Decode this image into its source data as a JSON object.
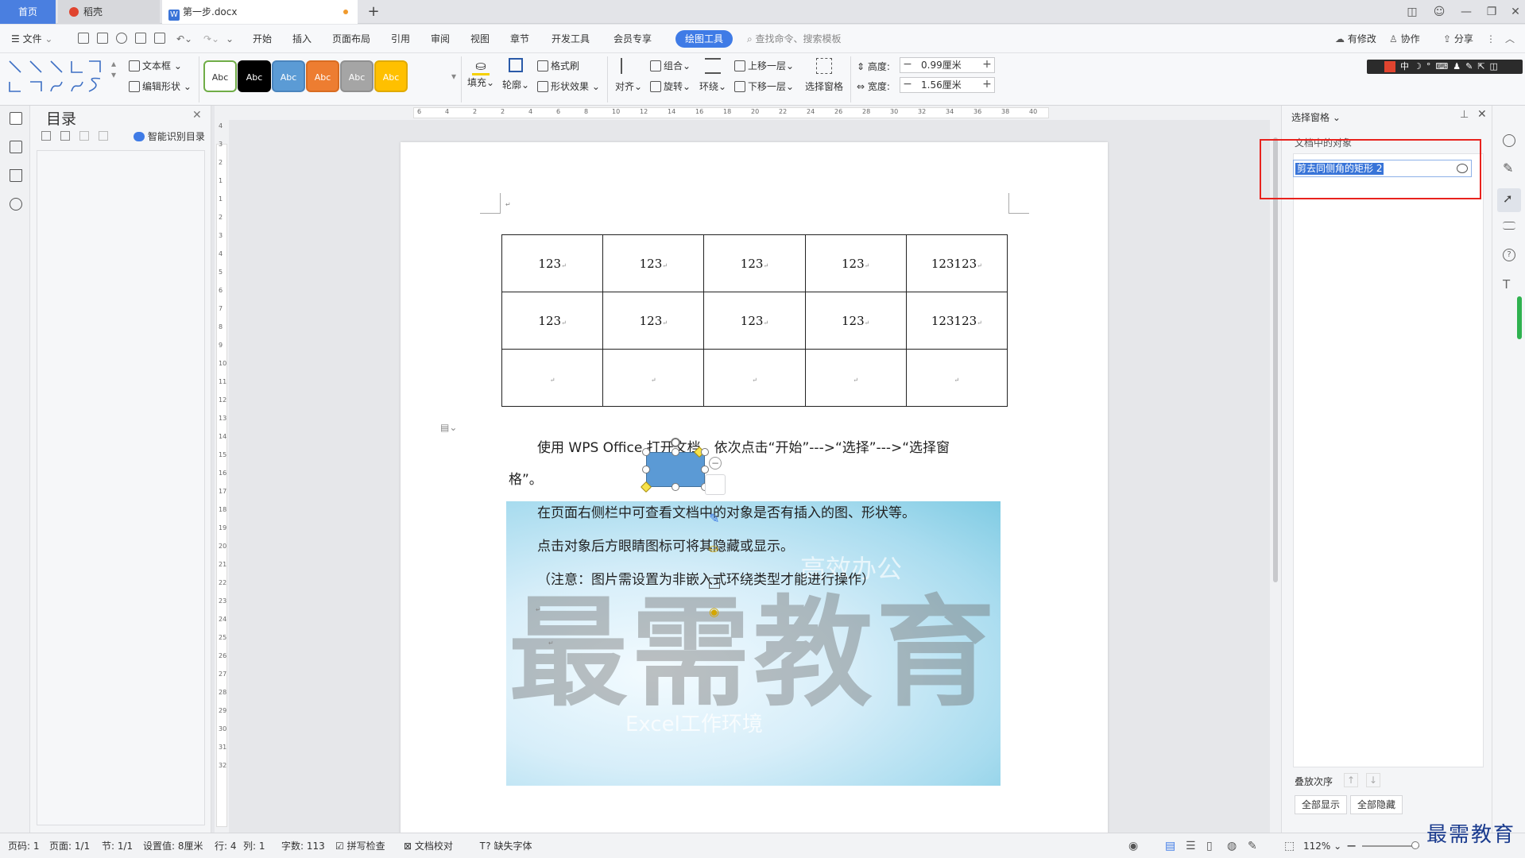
{
  "tabs": {
    "home": "首页",
    "daoke": "稻壳",
    "doc": "第一步.docx",
    "add": "+"
  },
  "menu": {
    "file": "文件",
    "items": [
      "开始",
      "插入",
      "页面布局",
      "引用",
      "审阅",
      "视图",
      "章节",
      "开发工具",
      "会员专享"
    ],
    "active": "绘图工具",
    "search": "查找命令、搜索模板",
    "right": [
      "有修改",
      "协作",
      "分享"
    ]
  },
  "ribbon": {
    "textbox": "文本框",
    "edit_shape": "编辑形状",
    "styles": [
      {
        "label": "Abc",
        "bg": "#ffffff",
        "fg": "#333333",
        "border": "#70ad47"
      },
      {
        "label": "Abc",
        "bg": "#000000",
        "fg": "#ffffff",
        "border": "#000000"
      },
      {
        "label": "Abc",
        "bg": "#5b9bd5",
        "fg": "#ffffff",
        "border": "#4a84bd"
      },
      {
        "label": "Abc",
        "bg": "#ed7d31",
        "fg": "#ffffff",
        "border": "#d86c22"
      },
      {
        "label": "Abc",
        "bg": "#a5a5a5",
        "fg": "#ffffff",
        "border": "#8f8f8f"
      },
      {
        "label": "Abc",
        "bg": "#ffc000",
        "fg": "#ffffff",
        "border": "#e0aa00"
      }
    ],
    "fill": "填充",
    "outline": "轮廓",
    "format_brush": "格式刷",
    "shape_effect": "形状效果",
    "align": "对齐",
    "group": "组合",
    "rotate": "旋转",
    "wrap": "环绕",
    "bring_forward": "上移一层",
    "send_backward": "下移一层",
    "select_pane": "选择窗格",
    "height_label": "高度:",
    "height_value": "0.99厘米",
    "width_label": "宽度:",
    "width_value": "1.56厘米"
  },
  "toc": {
    "title": "目录",
    "smart": "智能识别目录"
  },
  "ruler": {
    "h": [
      "6",
      "4",
      "2",
      "2",
      "4",
      "6",
      "8",
      "10",
      "12",
      "14",
      "16",
      "18",
      "20",
      "22",
      "24",
      "26",
      "28",
      "30",
      "32",
      "34",
      "36",
      "38",
      "40"
    ],
    "v": [
      "4",
      "3",
      "2",
      "1",
      "1",
      "2",
      "3",
      "4",
      "5",
      "6",
      "7",
      "8",
      "9",
      "10",
      "11",
      "12",
      "13",
      "14",
      "15",
      "16",
      "17",
      "18",
      "19",
      "20",
      "21",
      "22",
      "23",
      "24",
      "25",
      "26",
      "27",
      "28",
      "29",
      "30",
      "31",
      "32"
    ]
  },
  "document": {
    "table": [
      [
        "123",
        "123",
        "123",
        "123",
        "123123"
      ],
      [
        "123",
        "123",
        "123",
        "123",
        "123123"
      ],
      [
        "",
        "",
        "",
        "",
        ""
      ]
    ],
    "return_mark": "↵",
    "para1_a": "使用 WPS Office 打开文档，依次点击“开始”--->“选择”--->“选择窗",
    "para1_b": "格”。",
    "para2": "在页面右侧栏中可查看文档中的对象是否有插入的图、形状等。",
    "para3": "点击对象后方眼睛图标可将其隐藏或显示。",
    "para4": "（注意：图片需设置为非嵌入式环绕类型才能进行操作）",
    "watermark": "最需教育",
    "watermark_sub": "Excel工作环境",
    "watermark_mid": "高效办公"
  },
  "selection_pane": {
    "title": "选择窗格",
    "section": "文档中的对象",
    "item": "剪去同侧角的矩形 2",
    "order_label": "叠放次序",
    "show_all": "全部显示",
    "hide_all": "全部隐藏"
  },
  "status": {
    "page_num": "页码: 1",
    "pages": "页面: 1/1",
    "section": "节: 1/1",
    "setting": "设置值: 8厘米",
    "row": "行: 4",
    "col": "列: 1",
    "words": "字数: 113",
    "spell": "拼写检查",
    "proof": "文档校对",
    "missing_font": "缺失字体",
    "zoom": "112%"
  },
  "brand": "最需教育",
  "colors": {
    "accent": "#3f7be6",
    "highlight_box": "#e8221d"
  }
}
